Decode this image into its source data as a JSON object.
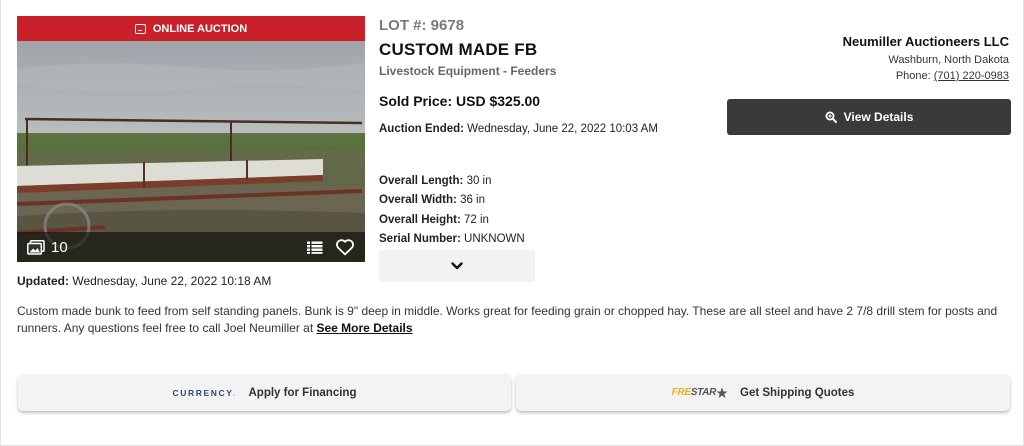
{
  "badge": {
    "label": "ONLINE AUCTION",
    "icon": "monitor-icon"
  },
  "photos": {
    "count": "10"
  },
  "updated": {
    "label": "Updated:",
    "value": "Wednesday, June 22, 2022 10:18 AM"
  },
  "lot": {
    "number": "LOT #: 9678",
    "title": "CUSTOM MADE FB",
    "category": "Livestock Equipment - Feeders"
  },
  "sold": {
    "text": "Sold Price: USD $325.00"
  },
  "ended": {
    "label": "Auction Ended:",
    "value": "Wednesday, June 22, 2022 10:03 AM"
  },
  "specs": [
    {
      "label": "Overall Length:",
      "value": "30 in"
    },
    {
      "label": "Overall Width:",
      "value": "36 in"
    },
    {
      "label": "Overall Height:",
      "value": "72 in"
    },
    {
      "label": "Serial Number:",
      "value": "UNKNOWN"
    }
  ],
  "seller": {
    "name": "Neumiller Auctioneers LLC",
    "location": "Washburn, North Dakota",
    "phone_label": "Phone:",
    "phone": "(701) 220-0983"
  },
  "view_details": {
    "label": "View Details"
  },
  "description": {
    "text": "Custom made bunk to feed from self standing panels. Bunk is 9\" deep in middle. Works great for feeding grain or chopped hay. These are all steel and have 2 7/8 drill stem for posts and runners. Any questions feel free to call Joel Neumiller at",
    "link": "See More Details"
  },
  "financing": {
    "logo": "CURRENCY",
    "label": "Apply for Financing"
  },
  "shipping": {
    "logo_part1": "FRE",
    "logo_part2": "STAR",
    "label": "Get Shipping Quotes"
  },
  "colors": {
    "badge": "#c9202a",
    "button_dark": "#3a3a3a",
    "currency": "#2c4a77",
    "frestar_gold": "#e8b21c"
  }
}
